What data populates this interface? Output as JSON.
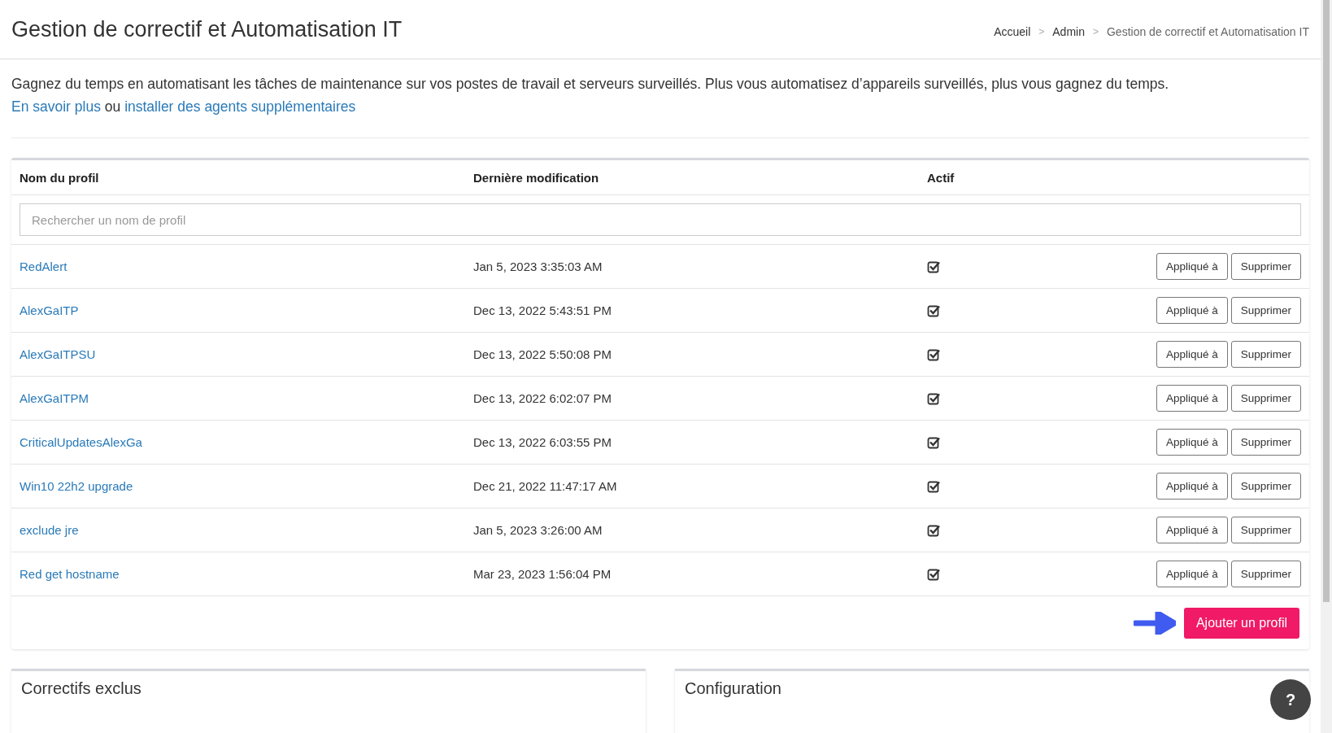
{
  "header": {
    "title": "Gestion de correctif et Automatisation IT",
    "breadcrumb": [
      "Accueil",
      "Admin",
      "Gestion de correctif et Automatisation IT"
    ],
    "breadcrumb_separator": ">"
  },
  "intro": {
    "text": "Gagnez du temps en automatisant les tâches de maintenance sur vos postes de travail et serveurs surveillés. Plus vous automatisez d’appareils surveillés, plus vous gagnez du temps.",
    "link_1": "En savoir plus",
    "joiner": "ou",
    "link_2": "installer des agents supplémentaires"
  },
  "table": {
    "columns": [
      "Nom du profil",
      "Dernière modification",
      "Actif"
    ],
    "search": {
      "placeholder": "Rechercher un nom de profil"
    },
    "rows": [
      {
        "name": "RedAlert",
        "modified": "Jan 5, 2023 3:35:03 AM",
        "active": true,
        "buttons": [
          "Appliqué à",
          "Supprimer"
        ]
      },
      {
        "name": "AlexGaITP",
        "modified": "Dec 13, 2022 5:43:51 PM",
        "active": true,
        "buttons": [
          "Appliqué à",
          "Supprimer"
        ]
      },
      {
        "name": "AlexGaITPSU",
        "modified": "Dec 13, 2022 5:50:08 PM",
        "active": true,
        "buttons": [
          "Appliqué à",
          "Supprimer"
        ]
      },
      {
        "name": "AlexGaITPM",
        "modified": "Dec 13, 2022 6:02:07 PM",
        "active": true,
        "buttons": [
          "Appliqué à",
          "Supprimer"
        ]
      },
      {
        "name": "CriticalUpdatesAlexGa",
        "modified": "Dec 13, 2022 6:03:55 PM",
        "active": true,
        "buttons": [
          "Appliqué à",
          "Supprimer"
        ]
      },
      {
        "name": "Win10 22h2 upgrade",
        "modified": "Dec 21, 2022 11:47:17 AM",
        "active": true,
        "buttons": [
          "Appliqué à",
          "Supprimer"
        ]
      },
      {
        "name": "exclude jre",
        "modified": "Jan 5, 2023 3:26:00 AM",
        "active": true,
        "buttons": [
          "Appliqué à",
          "Supprimer"
        ]
      },
      {
        "name": "Red get hostname",
        "modified": "Mar 23, 2023 1:56:04 PM",
        "active": true,
        "buttons": [
          "Appliqué à",
          "Supprimer"
        ]
      }
    ],
    "add_button": "Ajouter un profil"
  },
  "panels": [
    "Correctifs exclus",
    "Configuration"
  ],
  "help_button": "?"
}
